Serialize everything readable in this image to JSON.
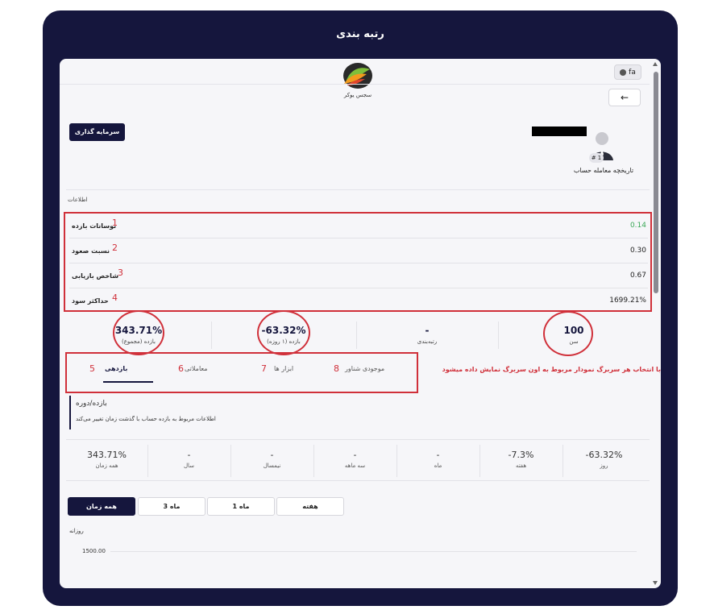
{
  "window": {
    "title": "رتبه بندی"
  },
  "header": {
    "lang_label": "fa",
    "logo_text": "سجس یوکر",
    "back_label": "←"
  },
  "profile": {
    "invest_button": "سرمایه گذاری",
    "rank_badge": "# 1",
    "history_label": "تاریخچه معامله حساب"
  },
  "info": {
    "title": "اطلاعات",
    "metrics": [
      {
        "label": "نوسانات بازده",
        "num": "1",
        "value": "0.14",
        "value_color": "#3aa856"
      },
      {
        "label": "نسبت صعود",
        "num": "2",
        "value": "0.30",
        "value_color": "#222222"
      },
      {
        "label": "شاخص بازیابی",
        "num": "3",
        "value": "0.67",
        "value_color": "#222222"
      },
      {
        "label": "حداکثر سود",
        "num": "4",
        "value": "1699.21%",
        "value_color": "#222222"
      }
    ]
  },
  "stats": [
    {
      "value": "343.71%",
      "label": "بازده (مجموع)"
    },
    {
      "value": "-63.32%",
      "label": "بازده (۱ روزه)"
    },
    {
      "value": "-",
      "label": "رتبه‌بندی"
    },
    {
      "value": "100",
      "label": "سن"
    }
  ],
  "tabs": [
    {
      "label": "بازدهی",
      "num": "5"
    },
    {
      "label": "معاملاتی",
      "num": "6"
    },
    {
      "label": "ابزار ها",
      "num": "7"
    },
    {
      "label": "موجودی شناور",
      "num": "8"
    }
  ],
  "notice": "با انتخاب هر سربرگ نمودار مربوط به اون سربرگ نمایش داده میشود",
  "period": {
    "title": "بازده/دوره",
    "desc": "اطلاعات مربوط به بازده حساب با گذشت زمان تغییر می‌کند"
  },
  "returns": [
    {
      "value": "343.71%",
      "label": "همه زمان"
    },
    {
      "value": "-",
      "label": "سال"
    },
    {
      "value": "-",
      "label": "نیمسال"
    },
    {
      "value": "-",
      "label": "سه ماهه"
    },
    {
      "value": "-",
      "label": "ماه"
    },
    {
      "value": "-7.3%",
      "label": "هفته"
    },
    {
      "value": "-63.32%",
      "label": "روز"
    }
  ],
  "ranges": [
    "همه زمان",
    "3 ماه",
    "1 ماه",
    "هفته"
  ],
  "chart": {
    "label": "روزانه",
    "y_tick": "1500.00"
  },
  "colors": {
    "navy": "#15163d",
    "annotation_red": "#d0303a",
    "positive_green": "#3aa856"
  }
}
